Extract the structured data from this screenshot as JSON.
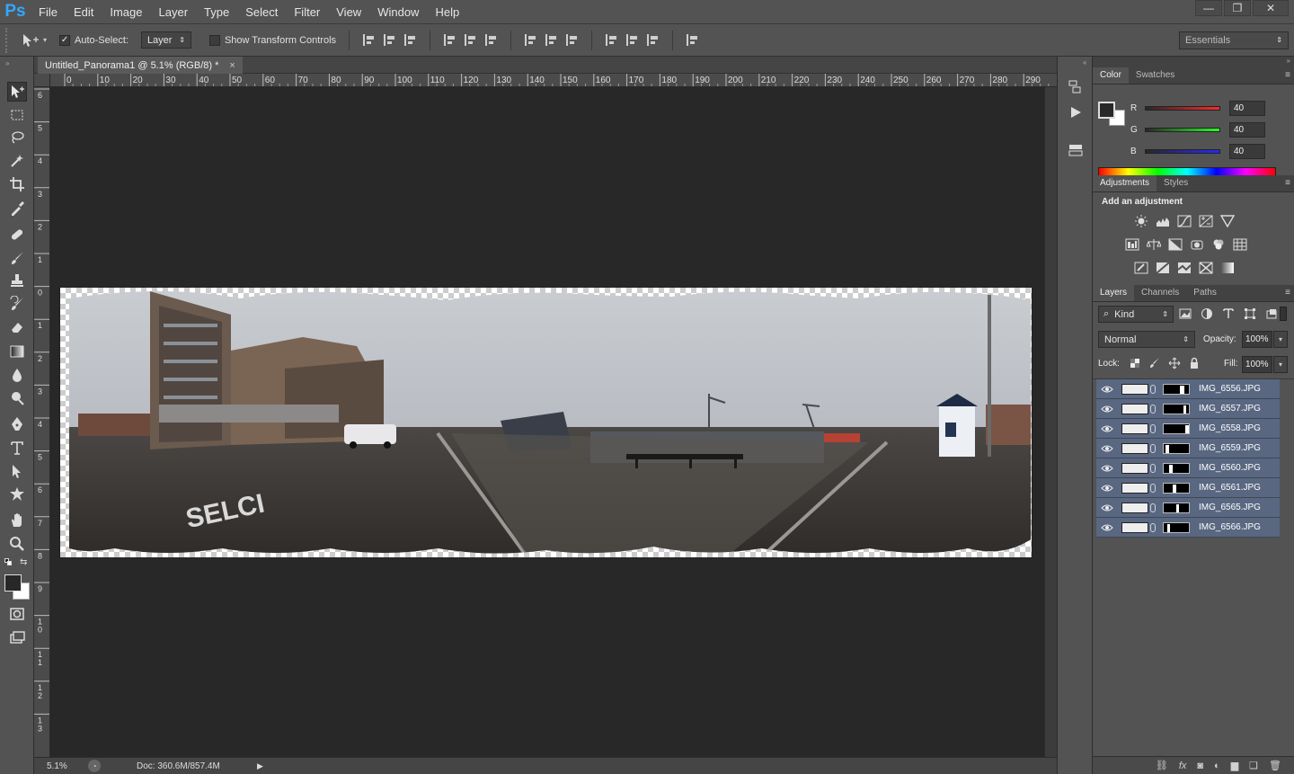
{
  "app": {
    "logo": "Ps"
  },
  "menu": [
    "File",
    "Edit",
    "Image",
    "Layer",
    "Type",
    "Select",
    "Filter",
    "View",
    "Window",
    "Help"
  ],
  "window_controls": {
    "minimize": "—",
    "restore": "❐",
    "close": "✕"
  },
  "options": {
    "auto_select_label": "Auto-Select:",
    "auto_select_checked": true,
    "auto_select_value": "Layer",
    "transform_label": "Show Transform Controls",
    "workspace": "Essentials"
  },
  "document": {
    "tab_title": "Untitled_Panorama1 @ 5.1% (RGB/8) *",
    "close": "×",
    "ruler_top": [
      "0",
      "10",
      "20",
      "30",
      "40",
      "50",
      "60",
      "70",
      "80",
      "90",
      "100",
      "110",
      "120",
      "130",
      "140",
      "150",
      "160",
      "170",
      "180",
      "190",
      "200",
      "210",
      "220",
      "230",
      "240",
      "250",
      "260",
      "270",
      "280",
      "290"
    ],
    "ruler_left": [
      "6",
      "5",
      "4",
      "3",
      "2",
      "1",
      "0",
      "1",
      "2",
      "3",
      "4",
      "5",
      "6",
      "7",
      "8",
      "9",
      "1 0",
      "1 1",
      "1 2",
      "1 3"
    ],
    "zoom": "5.1%",
    "doc_info": "Doc: 360.6M/857.4M"
  },
  "color_panel": {
    "tabs": [
      "Color",
      "Swatches"
    ],
    "channels": [
      {
        "label": "R",
        "value": "40"
      },
      {
        "label": "G",
        "value": "40"
      },
      {
        "label": "B",
        "value": "40"
      }
    ],
    "foreground": "#282828",
    "background": "#ffffff"
  },
  "adjustments_panel": {
    "tabs": [
      "Adjustments",
      "Styles"
    ],
    "heading": "Add an adjustment",
    "icons": [
      [
        "brightness-contrast-icon",
        "levels-icon",
        "curves-icon",
        "exposure-icon",
        "vibrance-icon"
      ],
      [
        "hue-saturation-icon",
        "color-balance-icon",
        "black-white-icon",
        "photo-filter-icon",
        "channel-mixer-icon",
        "color-lookup-icon"
      ],
      [
        "invert-icon",
        "posterize-icon",
        "threshold-icon",
        "selective-color-icon",
        "gradient-map-icon"
      ]
    ]
  },
  "layers_panel": {
    "tabs": [
      "Layers",
      "Channels",
      "Paths"
    ],
    "filter_kind": "Kind",
    "blend_mode": "Normal",
    "opacity_label": "Opacity:",
    "opacity": "100%",
    "lock_label": "Lock:",
    "fill_label": "Fill:",
    "fill": "100%",
    "layers": [
      "IMG_6556.JPG",
      "IMG_6557.JPG",
      "IMG_6558.JPG",
      "IMG_6559.JPG",
      "IMG_6560.JPG",
      "IMG_6561.JPG",
      "IMG_6565.JPG",
      "IMG_6566.JPG"
    ]
  },
  "layers_footer_icons": [
    "link-layers-icon",
    "fx-icon",
    "add-mask-icon",
    "new-adjustment-icon",
    "new-group-icon",
    "new-layer-icon",
    "delete-layer-icon"
  ],
  "colors": {
    "selected_layer": "#596781",
    "ps_blue": "#31a8ff"
  }
}
